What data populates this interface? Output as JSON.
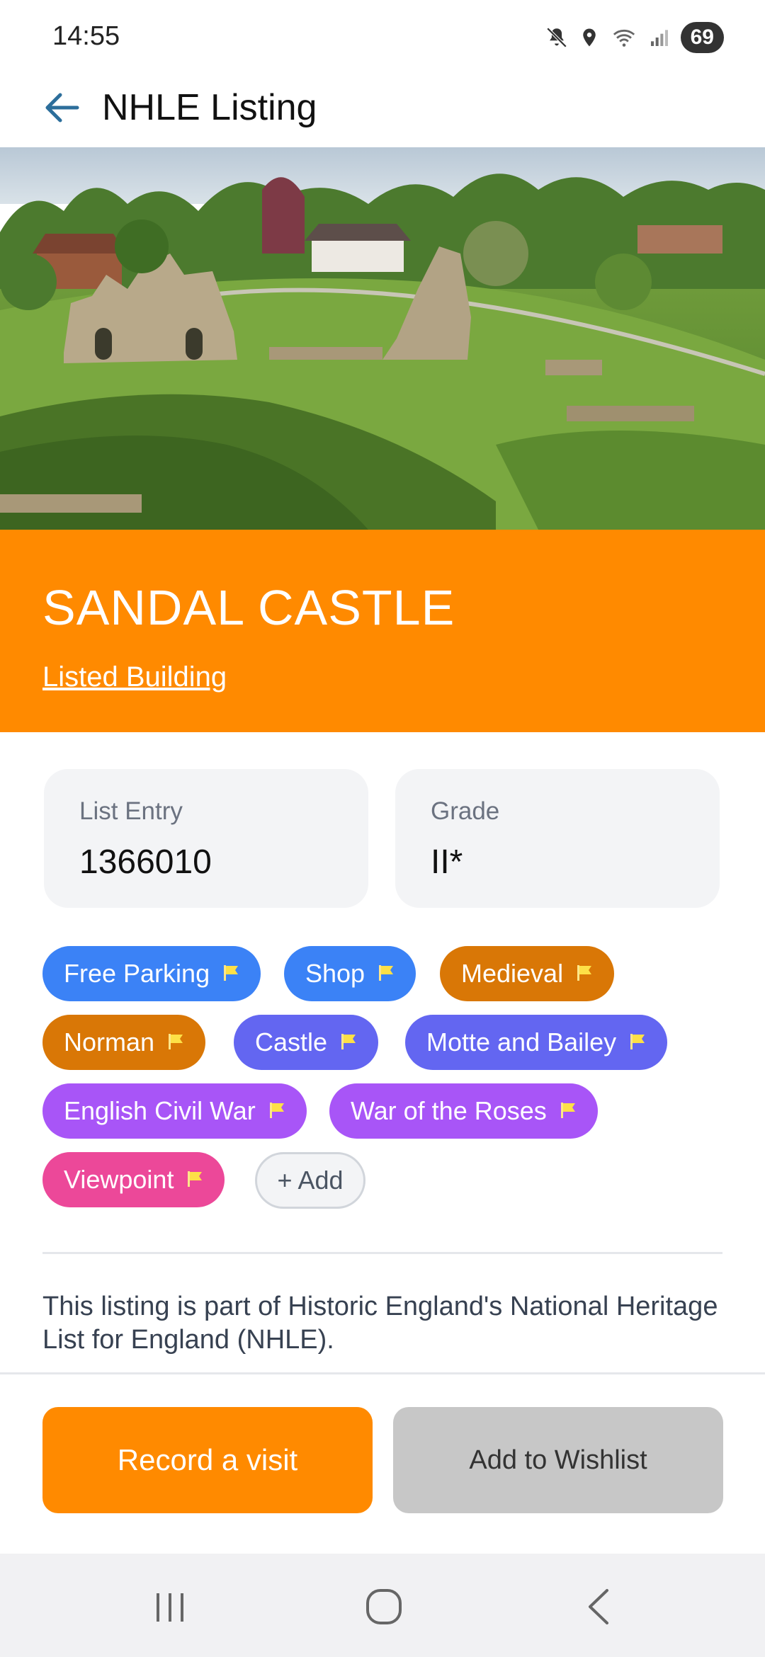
{
  "status_bar": {
    "time": "14:55",
    "battery": "69",
    "icons": [
      "mute-icon",
      "location-icon",
      "wifi-icon",
      "signal-icon"
    ]
  },
  "app_bar": {
    "back_icon": "back-arrow-icon",
    "title": "NHLE Listing"
  },
  "hero": {
    "image": "castle-ruins-photo"
  },
  "header": {
    "title": "SANDAL CASTLE",
    "listing_type": "Listed Building",
    "background": "#FF8A00"
  },
  "cards": {
    "list_entry": {
      "label": "List Entry",
      "value": "1366010"
    },
    "grade": {
      "label": "Grade",
      "value": "II*"
    }
  },
  "tags": [
    {
      "label": "Free Parking",
      "color": "#3B82F6"
    },
    {
      "label": "Shop",
      "color": "#3B82F6"
    },
    {
      "label": "Medieval",
      "color": "#D97706"
    },
    {
      "label": "Norman",
      "color": "#D97706"
    },
    {
      "label": "Castle",
      "color": "#6366F1"
    },
    {
      "label": "Motte and Bailey",
      "color": "#6366F1"
    },
    {
      "label": "English Civil War",
      "color": "#A855F7"
    },
    {
      "label": "War of the Roses",
      "color": "#A855F7"
    },
    {
      "label": "Viewpoint",
      "color": "#EC4899"
    }
  ],
  "add_tag_label": "+ Add",
  "description": "This listing is part of Historic England's National Heritage List for England (NHLE).",
  "actions": {
    "record_visit": "Record a visit",
    "add_wishlist": "Add to Wishlist"
  },
  "nav_bar": {
    "icons": [
      "recents-icon",
      "home-icon",
      "back-icon"
    ]
  }
}
